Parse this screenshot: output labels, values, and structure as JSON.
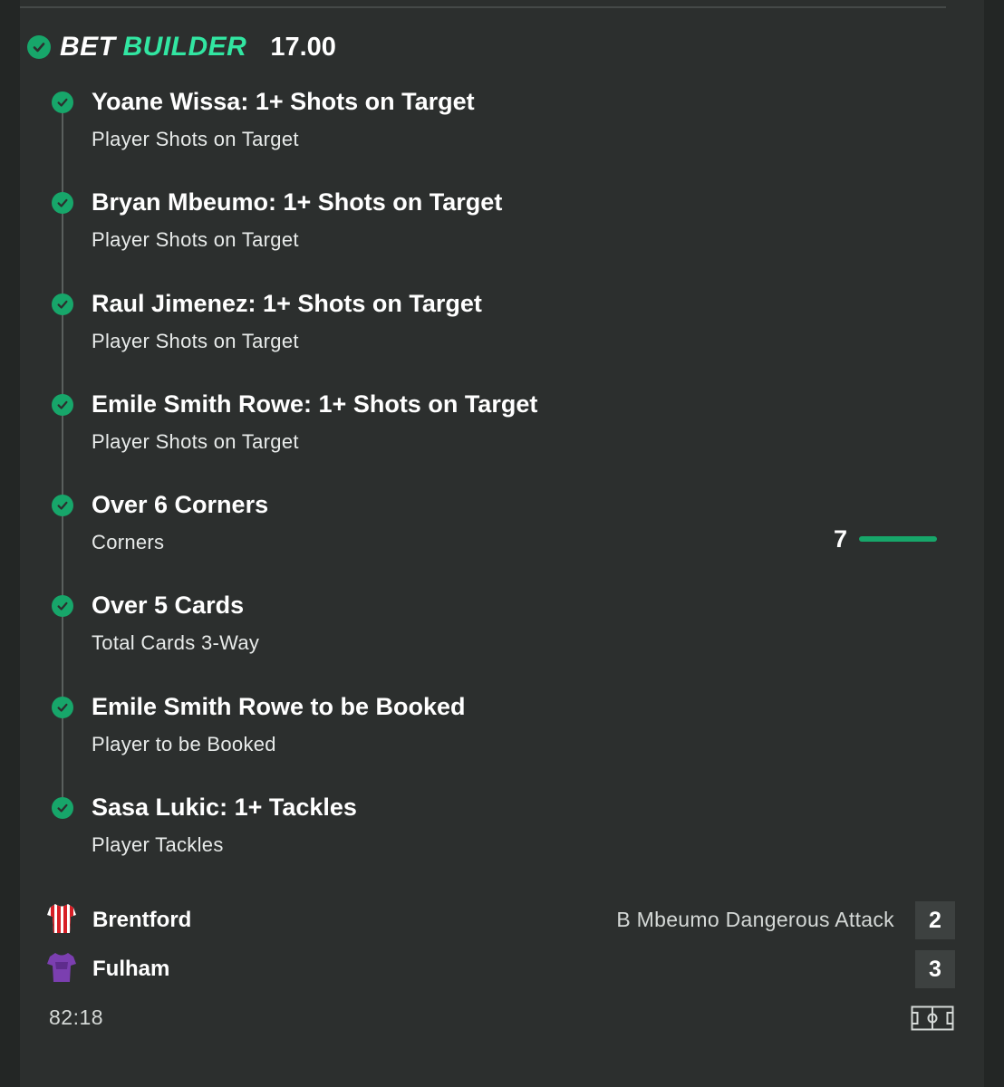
{
  "bet_builder": {
    "label_part1": "BET",
    "label_part2": "BUILDER",
    "odds": "17.00",
    "accent_color": "#32e6a2",
    "status_color": "#17a66a"
  },
  "legs": [
    {
      "title": "Yoane Wissa: 1+ Shots on Target",
      "market": "Player Shots on Target"
    },
    {
      "title": "Bryan Mbeumo: 1+ Shots on Target",
      "market": "Player Shots on Target"
    },
    {
      "title": "Raul Jimenez: 1+ Shots on Target",
      "market": "Player Shots on Target"
    },
    {
      "title": "Emile Smith Rowe: 1+ Shots on Target",
      "market": "Player Shots on Target"
    },
    {
      "title": "Over 6 Corners",
      "market": "Corners"
    },
    {
      "title": "Over 5 Cards",
      "market": "Total Cards 3-Way"
    },
    {
      "title": "Emile Smith Rowe to be Booked",
      "market": "Player to be Booked"
    },
    {
      "title": "Sasa Lukic: 1+ Tackles",
      "market": "Player Tackles"
    }
  ],
  "corners_progress": {
    "current": "7",
    "target": 6,
    "fill_fraction": 1.0
  },
  "match": {
    "home": {
      "name": "Brentford",
      "score": "2",
      "shirt_icon": "striped-red-white-shirt-icon"
    },
    "away": {
      "name": "Fulham",
      "score": "3",
      "shirt_icon": "purple-shirt-icon"
    },
    "live_event": "B Mbeumo Dangerous Attack",
    "clock": "82:18"
  }
}
